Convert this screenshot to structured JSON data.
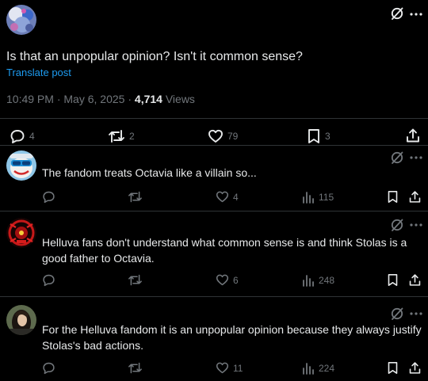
{
  "post": {
    "text": "Is that an unpopular opinion? Isn't it common sense?",
    "translate_label": "Translate post",
    "time": "10:49 PM",
    "date": "May 6, 2025",
    "separator": "·",
    "views_count": "4,714",
    "views_label": "Views",
    "replies": "4",
    "reposts": "2",
    "likes": "79",
    "bookmarks": "3"
  },
  "replies": [
    {
      "text": "The fandom treats Octavia like a villain so...",
      "likes": "4",
      "views": "115"
    },
    {
      "text": "Helluva fans don't understand what common sense is and think Stolas is a good father to Octavia.",
      "likes": "6",
      "views": "248"
    },
    {
      "text": "For the Helluva fandom it is an unpopular opinion because they always justify Stolas's bad actions.",
      "likes": "11",
      "views": "224"
    }
  ],
  "icons": {
    "grok": "grok-icon",
    "more": "more-icon",
    "reply": "reply-icon",
    "repost": "repost-icon",
    "like": "heart-icon",
    "views": "views-icon",
    "bookmark": "bookmark-icon",
    "share": "share-icon"
  },
  "colors": {
    "background": "#000000",
    "text": "#e7e9ea",
    "muted": "#71767b",
    "link": "#1d9bf0",
    "divider": "#2f3336"
  }
}
